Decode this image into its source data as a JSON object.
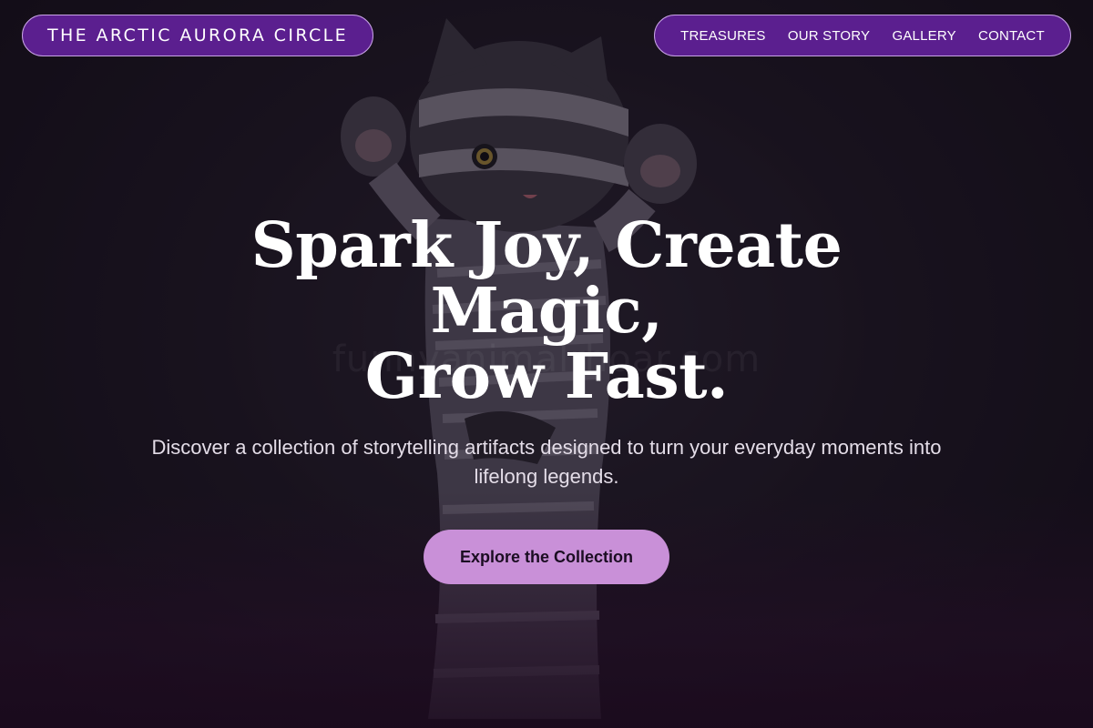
{
  "brand": {
    "name": "THE ARCTIC AURORA CIRCLE"
  },
  "nav": {
    "items": [
      {
        "label": "TREASURES"
      },
      {
        "label": "OUR STORY"
      },
      {
        "label": "GALLERY"
      },
      {
        "label": "CONTACT"
      }
    ]
  },
  "hero": {
    "title_line1": "Spark Joy, Create Magic,",
    "title_line2": "Grow Fast.",
    "subtitle": "Discover a collection of storytelling artifacts designed to turn your everyday moments into lifelong legends.",
    "cta_label": "Explore the Collection",
    "background_image": "mummy-cat-figurine",
    "watermark": "funnyanimalrhoar.com"
  },
  "colors": {
    "pill_background": "#5b1f8f",
    "pill_border": "#c9a4e6",
    "cta_background": "#c990d8",
    "page_background": "#17121c"
  }
}
